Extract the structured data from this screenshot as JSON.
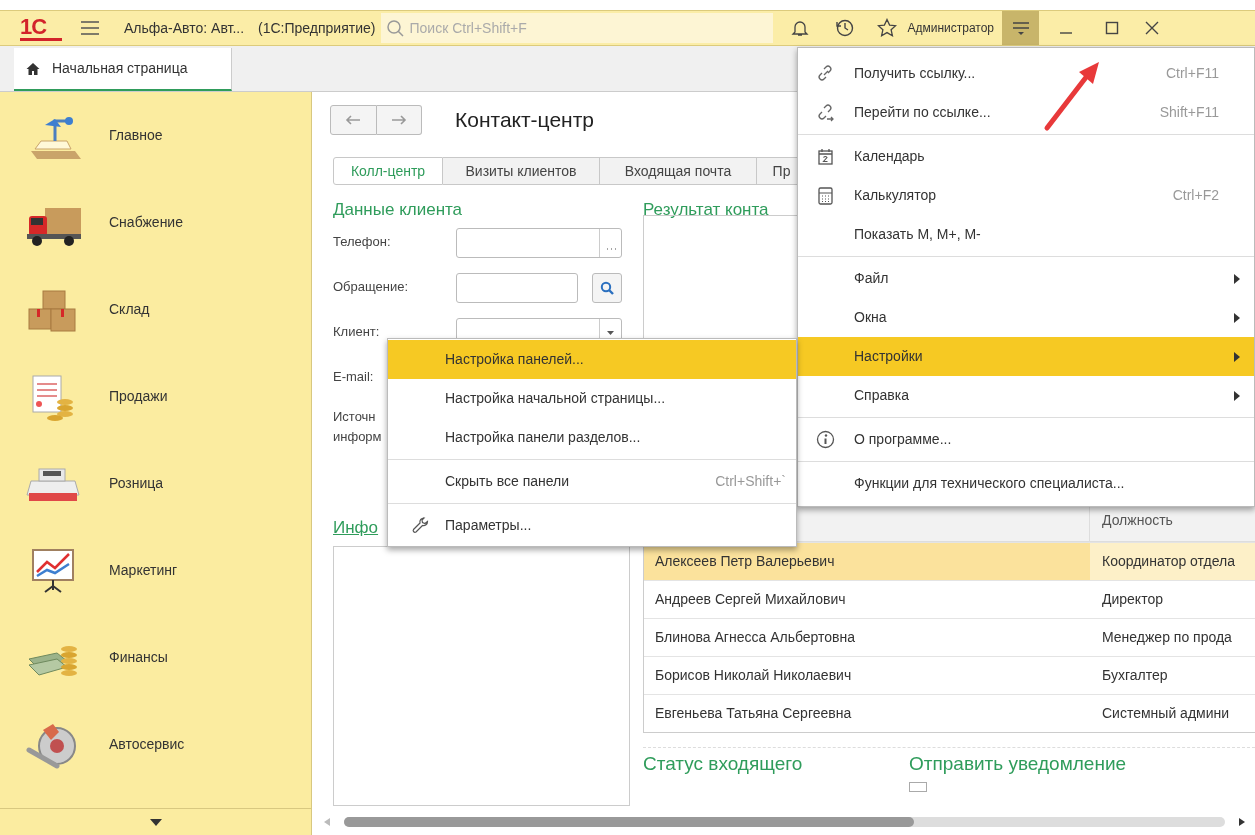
{
  "title_bar": {
    "logo": "1С",
    "title": "Альфа-Авто: Авт...",
    "app": "(1С:Предприятие)",
    "search": {
      "placeholder": "Поиск Ctrl+Shift+F"
    },
    "user": "Администратор",
    "menu_open": true
  },
  "tabs": [
    {
      "label": "Начальная страница",
      "selected": true
    }
  ],
  "sidebar": {
    "items": [
      {
        "label": "Главное",
        "kind": "lamp"
      },
      {
        "label": "Снабжение",
        "kind": "truck"
      },
      {
        "label": "Склад",
        "kind": "boxes"
      },
      {
        "label": "Продажи",
        "kind": "invoice"
      },
      {
        "label": "Розница",
        "kind": "register"
      },
      {
        "label": "Маркетинг",
        "kind": "chart"
      },
      {
        "label": "Финансы",
        "kind": "money"
      },
      {
        "label": "Автосервис",
        "kind": "brake"
      }
    ]
  },
  "content": {
    "title": "Контакт-центр",
    "tabs": [
      {
        "label": "Колл-центр",
        "selected": true
      },
      {
        "label": "Визиты клиентов",
        "selected": false
      },
      {
        "label": "Входящая почта",
        "selected": false
      },
      {
        "label": "Пр",
        "selected": false
      }
    ],
    "client_data": {
      "heading": "Данные клиента",
      "fields": [
        {
          "label": "Телефон:",
          "kind": "choice"
        },
        {
          "label": "Обращение:",
          "kind": "search"
        },
        {
          "label": "Клиент:",
          "kind": "dropdown"
        },
        {
          "label": "E-mail:",
          "kind": "label"
        },
        {
          "label": "Источн информ",
          "kind": "label"
        }
      ]
    },
    "info_link": "Инфо",
    "result": {
      "heading": "Результат конта"
    },
    "contacts_table": {
      "columns": [
        "",
        "Должность"
      ],
      "rows": [
        {
          "cells": [
            "Алексеев Петр Валерьевич",
            "Координатор отдела"
          ],
          "selected": true
        },
        {
          "cells": [
            "Андреев Сергей Михайлович",
            "Директор"
          ],
          "selected": false
        },
        {
          "cells": [
            "Блинова Агнесса Альбертовна",
            "Менеджер по прода"
          ],
          "selected": false
        },
        {
          "cells": [
            "Борисов Николай Николаевич",
            "Бухгалтер"
          ],
          "selected": false
        },
        {
          "cells": [
            "Евгеньева Татьяна Сергеевна",
            "Системный админи"
          ],
          "selected": false
        }
      ]
    },
    "status_heading": "Статус входящего",
    "notify_heading": "Отправить уведомление",
    "notify_checkbox": {
      "checked": false
    }
  },
  "main_menu": {
    "groups": [
      [
        {
          "label": "Получить ссылку...",
          "shortcut": "Ctrl+F11",
          "kind": "link",
          "has_submenu": false,
          "selected": false
        },
        {
          "label": "Перейти по ссылке...",
          "shortcut": "Shift+F11",
          "kind": "go-link",
          "has_submenu": false,
          "selected": false
        }
      ],
      [
        {
          "label": "Календарь",
          "kind": "calendar",
          "has_submenu": false,
          "selected": false
        },
        {
          "label": "Калькулятор",
          "shortcut": "Ctrl+F2",
          "kind": "calculator",
          "has_submenu": false,
          "selected": false
        },
        {
          "label": "Показать М, М+, М-",
          "kind": "none",
          "has_submenu": false,
          "selected": false
        }
      ],
      [
        {
          "label": "Файл",
          "kind": "none",
          "has_submenu": true,
          "selected": false
        },
        {
          "label": "Окна",
          "kind": "none",
          "has_submenu": true,
          "selected": false
        },
        {
          "label": "Настройки",
          "kind": "none",
          "has_submenu": true,
          "selected": true
        },
        {
          "label": "Справка",
          "kind": "none",
          "has_submenu": true,
          "selected": false
        }
      ],
      [
        {
          "label": "О программе...",
          "kind": "info",
          "has_submenu": false,
          "selected": false
        }
      ],
      [
        {
          "label": "Функции для технического специалиста...",
          "kind": "none",
          "has_submenu": false,
          "selected": false
        }
      ]
    ]
  },
  "submenu": {
    "groups": [
      [
        {
          "label": "Настройка панелей...",
          "kind": "none",
          "selected": true
        },
        {
          "label": "Настройка начальной страницы...",
          "kind": "none",
          "selected": false
        },
        {
          "label": "Настройка панели разделов...",
          "kind": "none",
          "selected": false
        }
      ],
      [
        {
          "label": "Скрыть все панели",
          "shortcut": "Ctrl+Shift+`",
          "kind": "none",
          "selected": false
        }
      ],
      [
        {
          "label": "Параметры...",
          "kind": "wrench",
          "selected": false
        }
      ]
    ]
  }
}
